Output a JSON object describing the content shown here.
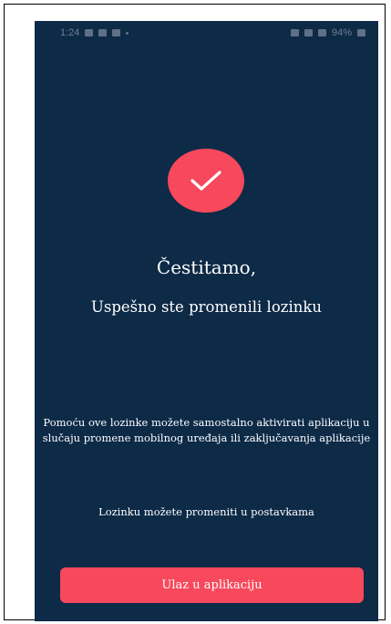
{
  "status_bar": {
    "time": "1:24",
    "battery": "94%"
  },
  "success_icon": "checkmark-icon",
  "title": "Čestitamo,",
  "subtitle": "Uspešno ste promenili lozinku",
  "body": "Pomoću ove lozinke možete samostalno aktivirati aplikaciju u slučaju promene mobilnog uređaja ili zaključavanja aplikacije",
  "hint": "Lozinku možete promeniti u postavkama",
  "enter_button_label": "Ulaz u aplikaciju",
  "colors": {
    "background": "#0d2a47",
    "accent": "#f7485c",
    "text": "#ffffff"
  }
}
